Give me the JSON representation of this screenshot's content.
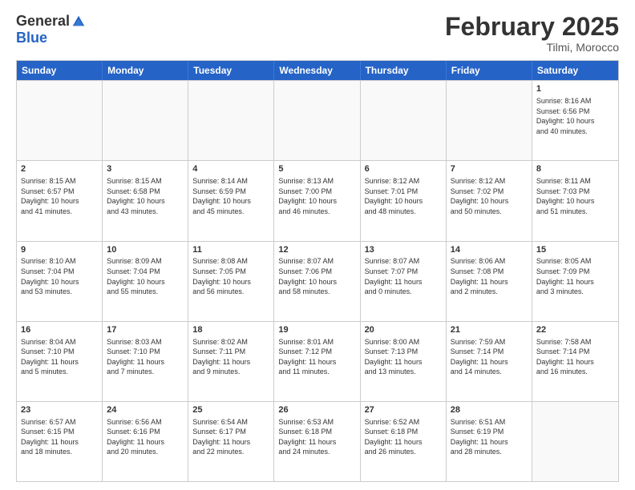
{
  "logo": {
    "general": "General",
    "blue": "Blue"
  },
  "header": {
    "month": "February 2025",
    "location": "Tilmi, Morocco"
  },
  "weekdays": [
    "Sunday",
    "Monday",
    "Tuesday",
    "Wednesday",
    "Thursday",
    "Friday",
    "Saturday"
  ],
  "rows": [
    [
      {
        "day": "",
        "info": ""
      },
      {
        "day": "",
        "info": ""
      },
      {
        "day": "",
        "info": ""
      },
      {
        "day": "",
        "info": ""
      },
      {
        "day": "",
        "info": ""
      },
      {
        "day": "",
        "info": ""
      },
      {
        "day": "1",
        "info": "Sunrise: 8:16 AM\nSunset: 6:56 PM\nDaylight: 10 hours\nand 40 minutes."
      }
    ],
    [
      {
        "day": "2",
        "info": "Sunrise: 8:15 AM\nSunset: 6:57 PM\nDaylight: 10 hours\nand 41 minutes."
      },
      {
        "day": "3",
        "info": "Sunrise: 8:15 AM\nSunset: 6:58 PM\nDaylight: 10 hours\nand 43 minutes."
      },
      {
        "day": "4",
        "info": "Sunrise: 8:14 AM\nSunset: 6:59 PM\nDaylight: 10 hours\nand 45 minutes."
      },
      {
        "day": "5",
        "info": "Sunrise: 8:13 AM\nSunset: 7:00 PM\nDaylight: 10 hours\nand 46 minutes."
      },
      {
        "day": "6",
        "info": "Sunrise: 8:12 AM\nSunset: 7:01 PM\nDaylight: 10 hours\nand 48 minutes."
      },
      {
        "day": "7",
        "info": "Sunrise: 8:12 AM\nSunset: 7:02 PM\nDaylight: 10 hours\nand 50 minutes."
      },
      {
        "day": "8",
        "info": "Sunrise: 8:11 AM\nSunset: 7:03 PM\nDaylight: 10 hours\nand 51 minutes."
      }
    ],
    [
      {
        "day": "9",
        "info": "Sunrise: 8:10 AM\nSunset: 7:04 PM\nDaylight: 10 hours\nand 53 minutes."
      },
      {
        "day": "10",
        "info": "Sunrise: 8:09 AM\nSunset: 7:04 PM\nDaylight: 10 hours\nand 55 minutes."
      },
      {
        "day": "11",
        "info": "Sunrise: 8:08 AM\nSunset: 7:05 PM\nDaylight: 10 hours\nand 56 minutes."
      },
      {
        "day": "12",
        "info": "Sunrise: 8:07 AM\nSunset: 7:06 PM\nDaylight: 10 hours\nand 58 minutes."
      },
      {
        "day": "13",
        "info": "Sunrise: 8:07 AM\nSunset: 7:07 PM\nDaylight: 11 hours\nand 0 minutes."
      },
      {
        "day": "14",
        "info": "Sunrise: 8:06 AM\nSunset: 7:08 PM\nDaylight: 11 hours\nand 2 minutes."
      },
      {
        "day": "15",
        "info": "Sunrise: 8:05 AM\nSunset: 7:09 PM\nDaylight: 11 hours\nand 3 minutes."
      }
    ],
    [
      {
        "day": "16",
        "info": "Sunrise: 8:04 AM\nSunset: 7:10 PM\nDaylight: 11 hours\nand 5 minutes."
      },
      {
        "day": "17",
        "info": "Sunrise: 8:03 AM\nSunset: 7:10 PM\nDaylight: 11 hours\nand 7 minutes."
      },
      {
        "day": "18",
        "info": "Sunrise: 8:02 AM\nSunset: 7:11 PM\nDaylight: 11 hours\nand 9 minutes."
      },
      {
        "day": "19",
        "info": "Sunrise: 8:01 AM\nSunset: 7:12 PM\nDaylight: 11 hours\nand 11 minutes."
      },
      {
        "day": "20",
        "info": "Sunrise: 8:00 AM\nSunset: 7:13 PM\nDaylight: 11 hours\nand 13 minutes."
      },
      {
        "day": "21",
        "info": "Sunrise: 7:59 AM\nSunset: 7:14 PM\nDaylight: 11 hours\nand 14 minutes."
      },
      {
        "day": "22",
        "info": "Sunrise: 7:58 AM\nSunset: 7:14 PM\nDaylight: 11 hours\nand 16 minutes."
      }
    ],
    [
      {
        "day": "23",
        "info": "Sunrise: 6:57 AM\nSunset: 6:15 PM\nDaylight: 11 hours\nand 18 minutes."
      },
      {
        "day": "24",
        "info": "Sunrise: 6:56 AM\nSunset: 6:16 PM\nDaylight: 11 hours\nand 20 minutes."
      },
      {
        "day": "25",
        "info": "Sunrise: 6:54 AM\nSunset: 6:17 PM\nDaylight: 11 hours\nand 22 minutes."
      },
      {
        "day": "26",
        "info": "Sunrise: 6:53 AM\nSunset: 6:18 PM\nDaylight: 11 hours\nand 24 minutes."
      },
      {
        "day": "27",
        "info": "Sunrise: 6:52 AM\nSunset: 6:18 PM\nDaylight: 11 hours\nand 26 minutes."
      },
      {
        "day": "28",
        "info": "Sunrise: 6:51 AM\nSunset: 6:19 PM\nDaylight: 11 hours\nand 28 minutes."
      },
      {
        "day": "",
        "info": ""
      }
    ]
  ]
}
